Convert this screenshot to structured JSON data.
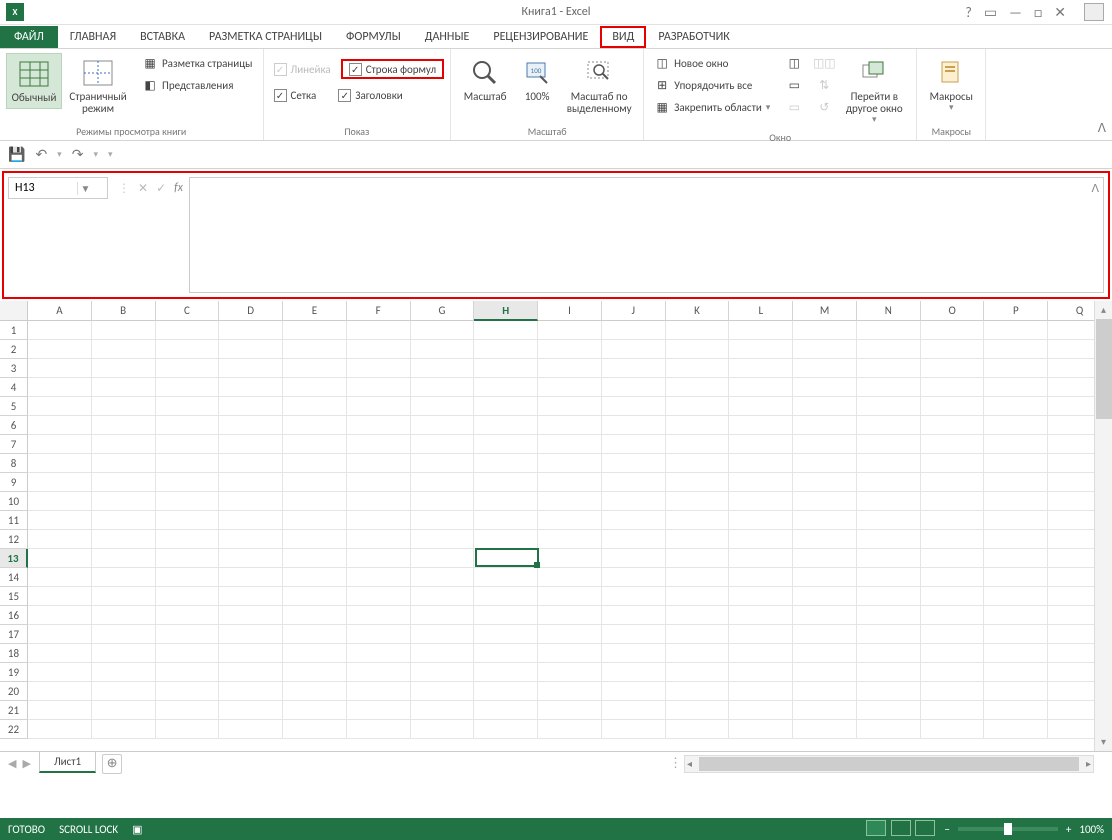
{
  "app": {
    "title": "Книга1 - Excel",
    "icon_text": "X"
  },
  "window_controls": {
    "help": "?",
    "ribbon_opts": "▭",
    "minimize": "—",
    "maximize": "□",
    "close": "✕"
  },
  "tabs": {
    "file": "ФАЙЛ",
    "items": [
      "ГЛАВНАЯ",
      "ВСТАВКА",
      "РАЗМЕТКА СТРАНИЦЫ",
      "ФОРМУЛЫ",
      "ДАННЫЕ",
      "РЕЦЕНЗИРОВАНИЕ",
      "ВИД",
      "РАЗРАБОТЧИК"
    ],
    "active": "ВИД"
  },
  "ribbon": {
    "group1": {
      "normal": "Обычный",
      "pagebreak": "Страничный режим",
      "pagelayout": "Разметка страницы",
      "customviews": "Представления",
      "label": "Режимы просмотра книги"
    },
    "group2": {
      "ruler": "Линейка",
      "formulabar": "Строка формул",
      "grid": "Сетка",
      "headings": "Заголовки",
      "label": "Показ"
    },
    "group3": {
      "zoom": "Масштаб",
      "hundred": "100%",
      "zoomselection": "Масштаб по выделенному",
      "label": "Масштаб"
    },
    "group4": {
      "newwindow": "Новое окно",
      "arrange": "Упорядочить все",
      "freeze": "Закрепить области",
      "switch": "Перейти в другое окно",
      "label": "Окно"
    },
    "group5": {
      "macros": "Макросы",
      "label": "Макросы"
    },
    "collapse": "ᐱ"
  },
  "qat": {
    "save": "💾",
    "undo": "↶",
    "redo": "↷",
    "custom": "▾"
  },
  "formula_bar": {
    "cell_ref": "H13",
    "cancel": "✕",
    "enter": "✓",
    "fx": "fx",
    "expand": "ᐱ"
  },
  "grid": {
    "columns": [
      "A",
      "B",
      "C",
      "D",
      "E",
      "F",
      "G",
      "H",
      "I",
      "J",
      "K",
      "L",
      "M",
      "N",
      "O",
      "P",
      "Q"
    ],
    "row_count": 22,
    "active_col": "H",
    "active_row": 13
  },
  "sheets": {
    "active": "Лист1",
    "add": "⊕"
  },
  "status": {
    "ready": "ГОТОВО",
    "scroll_lock": "SCROLL LOCK",
    "zoom": "100%",
    "minus": "−",
    "plus": "+"
  }
}
